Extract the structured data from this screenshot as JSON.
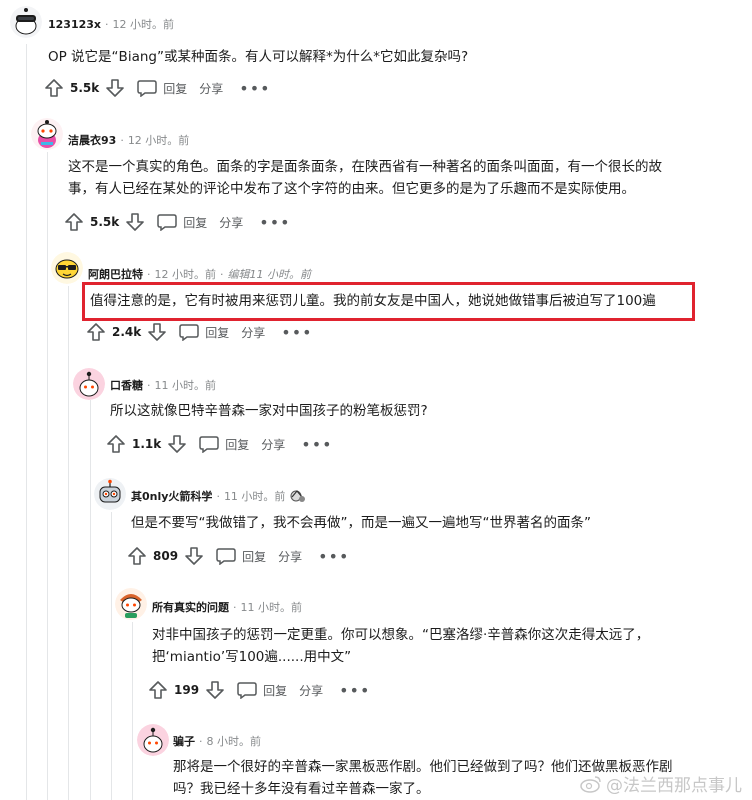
{
  "comments": [
    {
      "user": "123123x",
      "time": "12 小时。前",
      "text": "OP 说它是“Biang”或某种面条。有人可以解释*为什么*它如此复杂吗?",
      "votes": "5.5k",
      "reply": "回复",
      "share": "分享"
    },
    {
      "user": "洁晨衣93",
      "time": "12 小时。前",
      "text_line1": "这不是一个真实的角色。面条的字是面条面条，在陕西省有一种著名的面条叫面面，有一个很长的故",
      "text_line2": "事，有人已经在某处的评论中发布了这个字符的由来。但它更多的是为了乐趣而不是实际使用。",
      "votes": "5.5k",
      "reply": "回复",
      "share": "分享"
    },
    {
      "user": "阿朗巴拉特",
      "time": "12 小时。前",
      "edited": "编辑11 小时。前",
      "text": "值得注意的是，它有时被用来惩罚儿童。我的前女友是中国人，她说她做错事后被迫写了100遍",
      "votes": "2.4k",
      "reply": "回复",
      "share": "分享"
    },
    {
      "user": "口香糖",
      "time": "11 小时。前",
      "text": "所以这就像巴特辛普森一家对中国孩子的粉笔板惩罚?",
      "votes": "1.1k",
      "reply": "回复",
      "share": "分享"
    },
    {
      "user": "其0nly火箭科学",
      "time": "11 小时。前",
      "text": "但是不要写“我做错了，我不会再做”，而是一遍又一遍地写“世界著名的面条”",
      "votes": "809",
      "reply": "回复",
      "share": "分享"
    },
    {
      "user": "所有真实的问题",
      "time": "11 小时。前",
      "text_line1": "对非中国孩子的惩罚一定更重。你可以想象。“巴塞洛缪·辛普森你这次走得太远了，",
      "text_line2": "把‘miantio’写100遍......用中文”",
      "votes": "199",
      "reply": "回复",
      "share": "分享"
    },
    {
      "user": "骗子",
      "time": "8 小时。前",
      "text_line1": "那将是一个很好的辛普森一家黑板恶作剧。他们已经做到了吗？他们还做黑板恶作剧",
      "text_line2": "吗？我已经十多年没有看过辛普森一家了。"
    }
  ],
  "watermark": "@法兰西那点事儿",
  "colors": {
    "highlight": "#e0232f",
    "meta": "#878a8c",
    "text": "#1c1c1c",
    "thread_line": "#e4e6e8"
  }
}
